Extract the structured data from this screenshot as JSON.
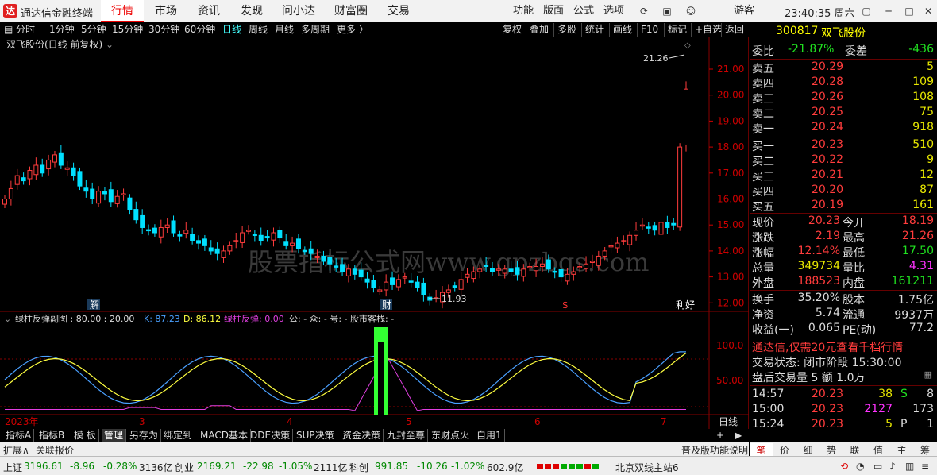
{
  "titlebar": {
    "logo": "达",
    "app": "通达信金融终端",
    "tabs": [
      "行情",
      "市场",
      "资讯",
      "发现",
      "问小达",
      "财富圈",
      "交易"
    ],
    "right": [
      "功能",
      "版面",
      "公式",
      "选项"
    ],
    "user": "游客",
    "clock": "23:40:35 周六"
  },
  "toolbar": {
    "periods": [
      "分时",
      "1分钟",
      "5分钟",
      "15分钟",
      "30分钟",
      "60分钟",
      "日线",
      "周线",
      "月线",
      "多周期",
      "更多 〉"
    ],
    "buttons": [
      "复权",
      "叠加",
      "多股",
      "统计",
      "画线",
      "F10",
      "标记",
      "+自选",
      "返回"
    ]
  },
  "chart": {
    "title": "双飞股份(日线 前复权)",
    "high_mark": "21.26",
    "low_mark": "11.93",
    "price_axis": [
      "21.00",
      "20.00",
      "19.00",
      "18.00",
      "17.00",
      "16.00",
      "15.00",
      "14.00",
      "13.00",
      "12.00"
    ],
    "event_marks": [
      "解",
      "财",
      "$",
      "利好"
    ],
    "watermark": "股票指标公式网www.gpzbgs.com",
    "indicator_title": "绿柱反弹副图 : 80.00 : 20.00",
    "k_label": "K: 87.23",
    "d_label": "D: 86.12",
    "green_label": "绿柱反弹: 0.00",
    "extra_label": "公: -  众: -  号: -  股市客栈: -",
    "ind_axis": [
      "100.0",
      "50.00"
    ],
    "x_labels": [
      "2023年",
      "3",
      "4",
      "5",
      "6",
      "7"
    ],
    "period_tag": "日线"
  },
  "quote": {
    "code": "300817",
    "name": "双飞股份",
    "weibi_label": "委比",
    "weibi": "-21.87%",
    "weicha_label": "委差",
    "weicha": "-436",
    "asks": [
      {
        "l": "卖五",
        "p": "20.29",
        "v": "5"
      },
      {
        "l": "卖四",
        "p": "20.28",
        "v": "109"
      },
      {
        "l": "卖三",
        "p": "20.26",
        "v": "108"
      },
      {
        "l": "卖二",
        "p": "20.25",
        "v": "75"
      },
      {
        "l": "卖一",
        "p": "20.24",
        "v": "918"
      }
    ],
    "bids": [
      {
        "l": "买一",
        "p": "20.23",
        "v": "510"
      },
      {
        "l": "买二",
        "p": "20.22",
        "v": "9"
      },
      {
        "l": "买三",
        "p": "20.21",
        "v": "12"
      },
      {
        "l": "买四",
        "p": "20.20",
        "v": "87"
      },
      {
        "l": "买五",
        "p": "20.19",
        "v": "161"
      }
    ],
    "stats": [
      {
        "a": "现价",
        "b": "20.23",
        "c": "今开",
        "d": "18.19"
      },
      {
        "a": "涨跌",
        "b": "2.19",
        "c": "最高",
        "d": "21.26"
      },
      {
        "a": "涨幅",
        "b": "12.14%",
        "c": "最低",
        "d": "17.50"
      },
      {
        "a": "总量",
        "b": "349734",
        "c": "量比",
        "d": "4.31"
      },
      {
        "a": "外盘",
        "b": "188523",
        "c": "内盘",
        "d": "161211"
      }
    ],
    "stats2": [
      {
        "a": "换手",
        "b": "35.20%",
        "c": "股本",
        "d": "1.75亿"
      },
      {
        "a": "净资",
        "b": "5.74",
        "c": "流通",
        "d": "9937万"
      },
      {
        "a": "收益(一)",
        "b": "0.065",
        "c": "PE(动)",
        "d": "77.2"
      }
    ],
    "promo": "通达信,仅需20元查看千档行情",
    "trade_state": "交易状态: 闭市阶段 15:30:00",
    "after_hours": "盘后交易量 5 额 1.0万",
    "ticks": [
      {
        "t": "14:57",
        "p": "20.23",
        "v": "38",
        "f": "S",
        "n": "8"
      },
      {
        "t": "15:00",
        "p": "20.23",
        "v": "2127",
        "f": "",
        "n": "173"
      },
      {
        "t": "15:24",
        "p": "20.23",
        "v": "5",
        "f": "P",
        "n": "1"
      }
    ]
  },
  "bottom_tabs": [
    "指标A",
    "指标B",
    "模 板",
    "管理",
    "另存为",
    "绑定到",
    "MACD基本",
    "DDE决策",
    "SUP决策",
    "资金决策",
    "九封至尊",
    "东财点火",
    "自用1"
  ],
  "bottom_right": [
    "+",
    "▶"
  ],
  "ext": {
    "expand": "扩展∧",
    "related": "关联报价",
    "func": "普及版功能说明"
  },
  "rtabs": [
    "笔",
    "价",
    "细",
    "势",
    "联",
    "值",
    "主",
    "筹"
  ],
  "status": {
    "sh_label": "上证",
    "sh": "3196.61",
    "sh_chg": "-8.96",
    "sh_pct": "-0.28%",
    "sh_amt": "3136亿",
    "cy_label": "创业",
    "cy": "2169.21",
    "cy_chg": "-22.98",
    "cy_pct": "-1.05%",
    "cy_amt": "2111亿",
    "kc_label": "科创",
    "kc": "991.85",
    "kc_chg": "-10.26",
    "kc_pct": "-1.02%",
    "kc_amt": "602.9亿",
    "server": "北京双线主站6"
  },
  "colors": {
    "up": "#ff3c3c",
    "down": "#00e0ff",
    "k_line": "#4aa0ff",
    "d_line": "#ffff40",
    "green_bar": "#33ff33",
    "magenta": "#e040e0"
  }
}
